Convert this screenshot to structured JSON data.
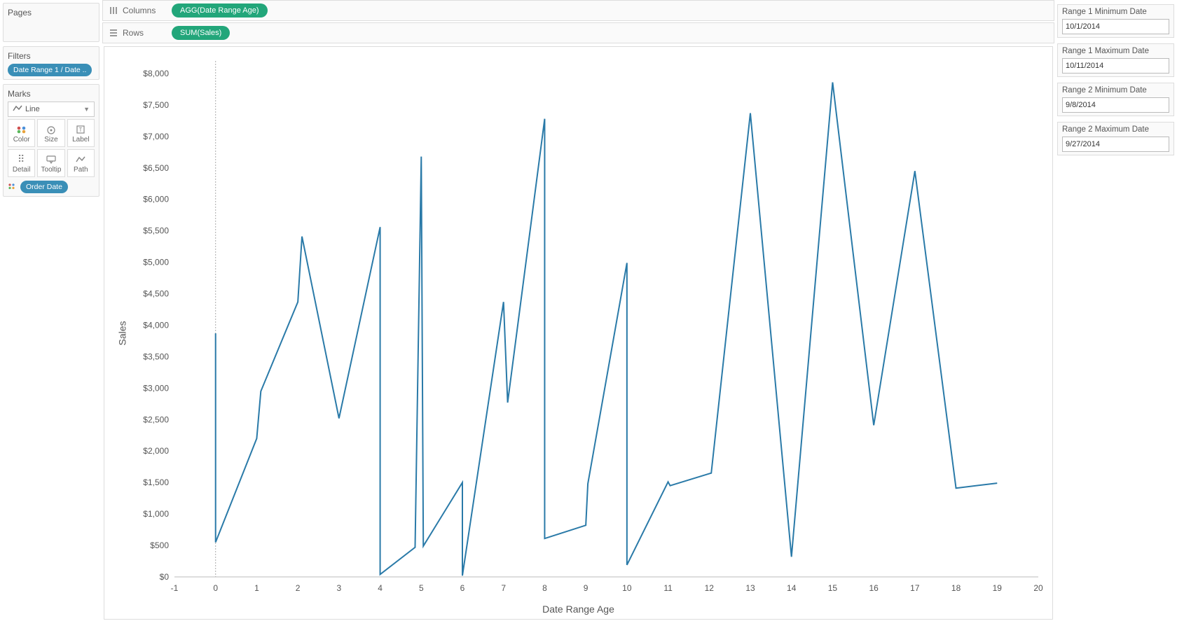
{
  "shelves": {
    "columns_label": "Columns",
    "rows_label": "Rows",
    "columns_pill": "AGG(Date Range Age)",
    "rows_pill": "SUM(Sales)"
  },
  "pages": {
    "title": "Pages"
  },
  "filters": {
    "title": "Filters",
    "pill": "Date Range 1 / Date .."
  },
  "marks": {
    "title": "Marks",
    "type": "Line",
    "cells": {
      "color": "Color",
      "size": "Size",
      "label": "Label",
      "detail": "Detail",
      "tooltip": "Tooltip",
      "path": "Path"
    },
    "color_pill": "Order Date"
  },
  "params": [
    {
      "label": "Range 1 Minimum Date",
      "value": "10/1/2014"
    },
    {
      "label": "Range 1 Maximum Date",
      "value": "10/11/2014"
    },
    {
      "label": "Range 2 Minimum Date",
      "value": "9/8/2014"
    },
    {
      "label": "Range 2 Maximum Date",
      "value": "9/27/2014"
    }
  ],
  "chart_data": {
    "type": "line",
    "xlabel": "Date Range Age",
    "ylabel": "Sales",
    "xlim": [
      -1,
      20
    ],
    "ylim": [
      0,
      8200
    ],
    "y_ticks": [
      0,
      500,
      1000,
      1500,
      2000,
      2500,
      3000,
      3500,
      4000,
      4500,
      5000,
      5500,
      6000,
      6500,
      7000,
      7500,
      8000
    ],
    "y_tick_labels": [
      "$0",
      "$500",
      "$1,000",
      "$1,500",
      "$2,000",
      "$2,500",
      "$3,000",
      "$3,500",
      "$4,000",
      "$4,500",
      "$5,000",
      "$5,500",
      "$6,000",
      "$6,500",
      "$7,000",
      "$7,500",
      "$8,000"
    ],
    "x_ticks": [
      -1,
      0,
      1,
      2,
      3,
      4,
      5,
      6,
      7,
      8,
      9,
      10,
      11,
      12,
      13,
      14,
      15,
      16,
      17,
      18,
      19,
      20
    ],
    "series": [
      {
        "name": "Sales",
        "points": [
          [
            0,
            3870
          ],
          [
            0,
            550
          ],
          [
            1,
            2200
          ],
          [
            1.1,
            2950
          ],
          [
            2,
            4370
          ],
          [
            2.1,
            5410
          ],
          [
            3,
            2520
          ],
          [
            4,
            5560
          ],
          [
            4,
            40
          ],
          [
            4.85,
            470
          ],
          [
            5,
            6680
          ],
          [
            5.05,
            490
          ],
          [
            6,
            1500
          ],
          [
            6,
            20
          ],
          [
            7,
            4370
          ],
          [
            7.1,
            2770
          ],
          [
            8,
            7280
          ],
          [
            8,
            610
          ],
          [
            9,
            820
          ],
          [
            9.05,
            1480
          ],
          [
            10,
            4990
          ],
          [
            10,
            190
          ],
          [
            11,
            1510
          ],
          [
            11.05,
            1450
          ],
          [
            12,
            1640
          ],
          [
            12.05,
            1650
          ],
          [
            13,
            7370
          ],
          [
            14,
            320
          ],
          [
            15,
            7860
          ],
          [
            16,
            2410
          ],
          [
            17,
            6450
          ],
          [
            18,
            1410
          ],
          [
            19,
            1490
          ]
        ]
      }
    ]
  }
}
